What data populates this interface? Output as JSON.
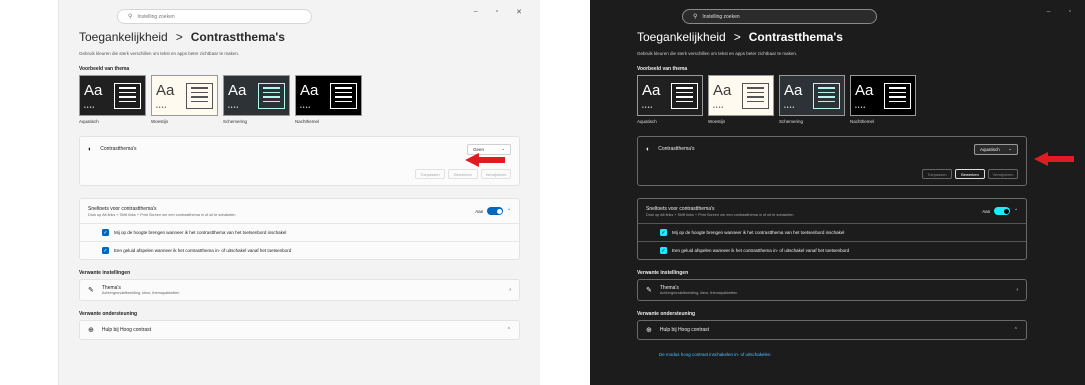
{
  "search_placeholder": "Instelling zoeken",
  "window_controls": [
    "–",
    "▫",
    "✕"
  ],
  "breadcrumb": {
    "parent": "Toegankelijkheid",
    "separator": ">",
    "current": "Contrastthema's"
  },
  "description": "Gebruik kleuren die sterk verschillen om tekst en apps beter zichtbaar te maken.",
  "preview_section_title": "Voorbeeld van thema",
  "themes": [
    {
      "name": "Aquatisch",
      "sample": "Aa"
    },
    {
      "name": "Woestijn",
      "sample": "Aa"
    },
    {
      "name": "Schemering",
      "sample": "Aa"
    },
    {
      "name": "Nachthemel",
      "sample": "Aa"
    }
  ],
  "contrast_card": {
    "label": "Contrastthema's",
    "buttons": [
      "Toepassen",
      "Bewerken",
      "Verwijderen"
    ]
  },
  "left_state": {
    "dropdown_value": "Geen"
  },
  "right_state": {
    "dropdown_value": "Aquatisch"
  },
  "shortcut": {
    "title": "Sneltoets voor contrastthema's",
    "subtitle": "Druk op Alt links + Shift links + Print Screen om een contrastthema in of uit te schakelen",
    "toggle_label": "Aan",
    "toggle_on": true,
    "options": [
      "Mij op de hoogte brengen wanneer ik het contrastthema van het toetsenbord inschakel",
      "Een geluid afspelen wanneer ik het contrastthema in- of uitschakel vanaf het toetsenbord"
    ]
  },
  "related_settings": {
    "title": "Verwante instellingen",
    "item_title": "Thema's",
    "item_subtitle": "Achtergrondafbeelding, kleur, themapakketten"
  },
  "related_support": {
    "title": "Verwante ondersteuning",
    "item_title": "Hulp bij Hoog contrast",
    "link": "De modus hoog contrast inschakelen in- of uitschakelen"
  },
  "colors": {
    "accent_light": "#0067c0",
    "accent_dark": "#1aebff",
    "arrow": "#e11b22"
  },
  "icons": [
    "search-icon",
    "contrast-icon",
    "chevron-down-icon",
    "chevron-up-icon",
    "brush-icon",
    "chevron-right-icon",
    "globe-icon",
    "checkmark-icon",
    "arrow-icon"
  ]
}
